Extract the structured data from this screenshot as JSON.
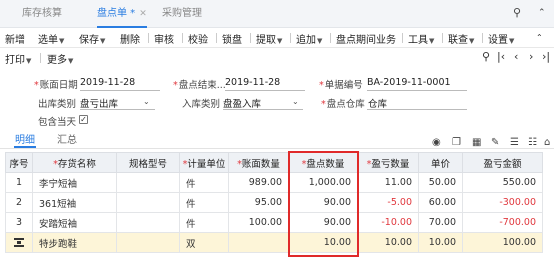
{
  "tabs": [
    {
      "label": "库存核算",
      "active": false
    },
    {
      "label": "盘点单 *",
      "active": true
    },
    {
      "label": "采购管理",
      "active": false
    }
  ],
  "window_controls": {
    "search_icon": "search-icon",
    "collapse_icon": "chevron-up-icon"
  },
  "toolbar": {
    "items": [
      "新增",
      "选单",
      "保存",
      "删除",
      "审核",
      "校验",
      "锁盘",
      "提取",
      "追加",
      "盘点期间业务",
      "工具",
      "联查",
      "设置"
    ],
    "print": "打印",
    "more": "更多"
  },
  "form": {
    "date_label": "账面日期",
    "date_value": "2019-11-28",
    "end_label": "盘点结束...",
    "end_value": "2019-11-28",
    "doc_no_label": "单据编号",
    "doc_no_value": "BA-2019-11-0001",
    "out_type_label": "出库类别",
    "out_type_value": "盘亏出库",
    "in_type_label": "入库类别",
    "in_type_value": "盘盈入库",
    "warehouse_label": "盘点仓库",
    "warehouse_value": "仓库",
    "include_today_label": "包含当天",
    "include_today_checked": true
  },
  "subtabs": {
    "detail": "明细",
    "summary": "汇总"
  },
  "table": {
    "headers": {
      "seq": "序号",
      "name": "存货名称",
      "spec": "规格型号",
      "unit": "计量单位",
      "book_qty": "账面数量",
      "count_qty": "盘点数量",
      "diff_qty": "盈亏数量",
      "price": "单价",
      "diff_amount": "盈亏金额"
    },
    "rows": [
      {
        "seq": "1",
        "name": "李宁短袖",
        "spec": "",
        "unit": "件",
        "book_qty": "989.00",
        "count_qty": "1,000.00",
        "diff_qty": "11.00",
        "price": "50.00",
        "diff_amount": "550.00"
      },
      {
        "seq": "2",
        "name": "361短袖",
        "spec": "",
        "unit": "件",
        "book_qty": "95.00",
        "count_qty": "90.00",
        "diff_qty": "-5.00",
        "price": "60.00",
        "diff_amount": "-300.00"
      },
      {
        "seq": "3",
        "name": "安踏短袖",
        "spec": "",
        "unit": "件",
        "book_qty": "100.00",
        "count_qty": "90.00",
        "diff_qty": "-10.00",
        "price": "70.00",
        "diff_amount": "-700.00"
      },
      {
        "seq": "",
        "name": "特步跑鞋",
        "spec": "",
        "unit": "双",
        "book_qty": "",
        "count_qty": "10.00",
        "diff_qty": "10.00",
        "price": "10.00",
        "diff_amount": "100.00"
      }
    ]
  },
  "colors": {
    "accent": "#2a7de1",
    "negative": "#e0383e",
    "highlight_box": "#e02a2a",
    "selected_row": "#fdf5d8"
  }
}
